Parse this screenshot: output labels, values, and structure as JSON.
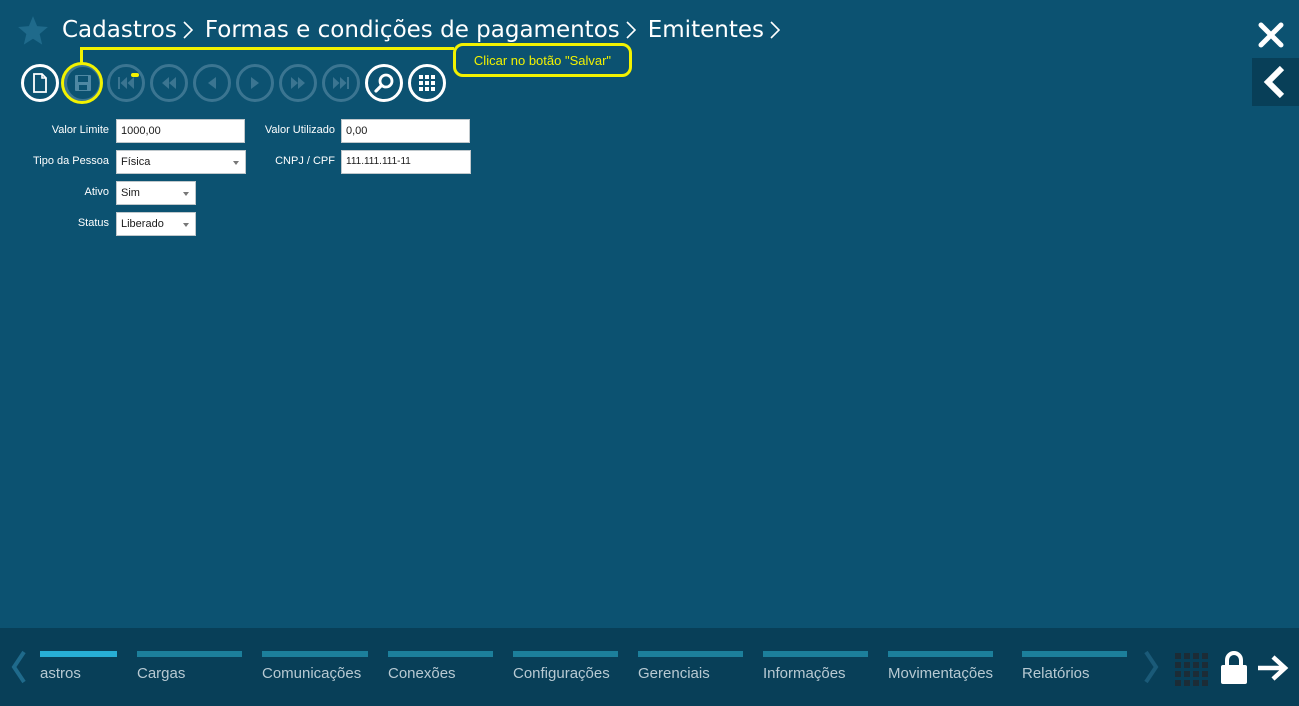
{
  "header": {
    "breadcrumb": [
      "Cadastros",
      "Formas e condições de pagamentos",
      "Emitentes"
    ],
    "icons": {
      "favorite": "star-icon",
      "close": "close-icon",
      "back": "chevron-left-icon"
    }
  },
  "toolbar": {
    "buttons": [
      {
        "name": "new-document",
        "icon": "document-icon",
        "enabled": true
      },
      {
        "name": "save",
        "icon": "save-icon",
        "enabled": true,
        "highlighted": true
      },
      {
        "name": "first-record",
        "icon": "skip-first-icon",
        "enabled": false
      },
      {
        "name": "rewind",
        "icon": "rewind-icon",
        "enabled": false
      },
      {
        "name": "previous",
        "icon": "previous-icon",
        "enabled": false
      },
      {
        "name": "next",
        "icon": "next-icon",
        "enabled": false
      },
      {
        "name": "fast-forward",
        "icon": "fast-forward-icon",
        "enabled": false
      },
      {
        "name": "last-record",
        "icon": "skip-last-icon",
        "enabled": false
      },
      {
        "name": "search",
        "icon": "search-icon",
        "enabled": true
      },
      {
        "name": "grid",
        "icon": "grid-icon",
        "enabled": true
      }
    ]
  },
  "callout": {
    "text": "Clicar no botão \"Salvar\"",
    "color": "#f2f201"
  },
  "form": {
    "valor_limite": {
      "label": "Valor Limite",
      "value": "1000,00"
    },
    "valor_utilizado": {
      "label": "Valor Utilizado",
      "value": "0,00"
    },
    "tipo_pessoa": {
      "label": "Tipo da Pessoa",
      "value": "Física"
    },
    "cnpj_cpf": {
      "label": "CNPJ / CPF",
      "value": "111.111.111-11"
    },
    "ativo": {
      "label": "Ativo",
      "value": "Sim"
    },
    "status": {
      "label": "Status",
      "value": "Liberado"
    }
  },
  "bottom_nav": {
    "modules": [
      {
        "label": "astros",
        "active": true
      },
      {
        "label": "Cargas"
      },
      {
        "label": "Comunicações"
      },
      {
        "label": "Conexões"
      },
      {
        "label": "Configurações"
      },
      {
        "label": "Gerenciais"
      },
      {
        "label": "Informações"
      },
      {
        "label": "Movimentações"
      },
      {
        "label": "Relatórios"
      }
    ],
    "icons": {
      "left": "chevron-left-icon",
      "right": "chevron-right-icon",
      "apps": "grid-icon",
      "lock": "lock-icon",
      "logout": "arrow-right-icon"
    }
  },
  "colors": {
    "background": "#0c5271",
    "bottom_bar": "#083f58",
    "active_module": "#27aed5",
    "module_bar": "#1c7f9b",
    "highlight": "#f2f201"
  }
}
